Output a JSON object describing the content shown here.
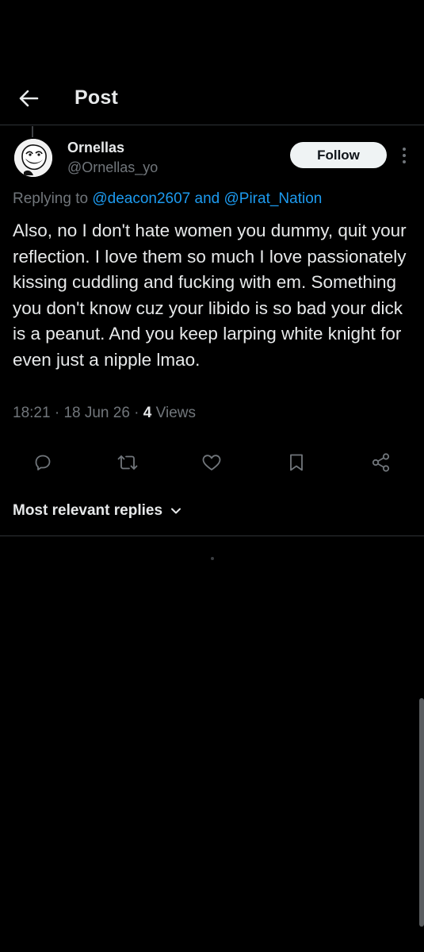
{
  "header": {
    "title": "Post"
  },
  "tweet": {
    "author_name": "Ornellas",
    "author_handle": "@Ornellas_yo",
    "follow_label": "Follow",
    "replying_prefix": "Replying to ",
    "mention_1": "@deacon2607",
    "replying_and": " and ",
    "mention_2": "@Pirat_Nation",
    "text": "Also, no I don't hate women you dummy, quit your reflection. I love them so much I love passionately kissing cuddling and fucking with em. Something you don't know cuz your libido is so bad your dick is a peanut. And you keep larping white knight for even just a nipple lmao.",
    "time": "18:21",
    "date": "18 Jun 26",
    "views_count": "4",
    "views_label": "Views"
  },
  "actions": {
    "icons": [
      "reply-icon",
      "retweet-icon",
      "like-icon",
      "bookmark-icon",
      "share-icon"
    ]
  },
  "replies": {
    "sort_label": "Most relevant replies"
  },
  "colors": {
    "background": "#000000",
    "text_primary": "#e7e9ea",
    "text_secondary": "#71767b",
    "accent": "#1d9bf0",
    "divider": "#2f3336"
  }
}
